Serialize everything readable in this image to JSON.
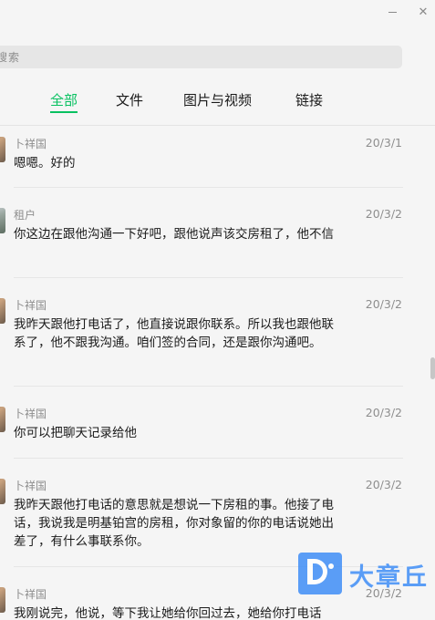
{
  "window": {
    "minimize_icon": "minimize-icon",
    "close_icon": "close-icon",
    "close_glyph": "✕"
  },
  "search": {
    "placeholder": "搜索"
  },
  "tabs": [
    {
      "label": "全部",
      "active": true
    },
    {
      "label": "文件",
      "active": false
    },
    {
      "label": "图片与视频",
      "active": false
    },
    {
      "label": "链接",
      "active": false
    }
  ],
  "messages": [
    {
      "sender": "卜祥国",
      "date": "20/3/1",
      "text": "嗯嗯。好的"
    },
    {
      "sender": "租户",
      "date": "20/3/2",
      "text": "你这边在跟他沟通一下好吧，跟他说声该交房租了，他不信"
    },
    {
      "sender": "卜祥国",
      "date": "20/3/2",
      "text": "我昨天跟他打电话了，他直接说跟你联系。所以我也跟他联系了，他不跟我沟通。咱们签的合同，还是跟你沟通吧。"
    },
    {
      "sender": "卜祥国",
      "date": "20/3/2",
      "text": "你可以把聊天记录给他"
    },
    {
      "sender": "卜祥国",
      "date": "20/3/2",
      "text": "我昨天跟他打电话的意思就是想说一下房租的事。他接了电话，我说我是明基铂宫的房租，你对象留的你的电话说她出差了，有什么事联系你。"
    },
    {
      "sender": "卜祥国",
      "date": "20/3/2",
      "text": "我刚说完，他说，等下我让她给你回过去，她给你打电话"
    }
  ],
  "watermark": {
    "text": "大章丘"
  },
  "colors": {
    "accent": "#07c160",
    "watermark": "#3f8ef7"
  }
}
